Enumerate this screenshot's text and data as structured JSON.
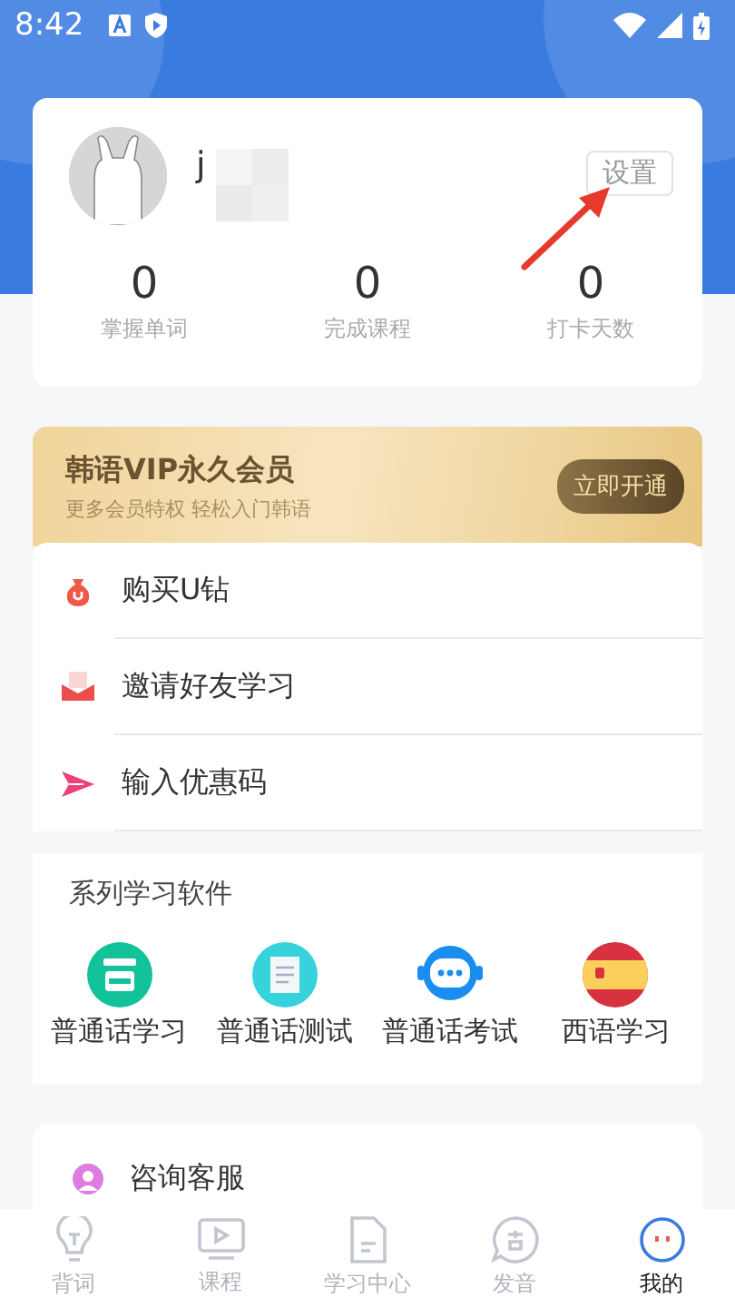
{
  "status_bar": {
    "time": "8:42"
  },
  "profile": {
    "name": "j",
    "settings_button": "设置",
    "stats": [
      {
        "value": "0",
        "label": "掌握单词"
      },
      {
        "value": "0",
        "label": "完成课程"
      },
      {
        "value": "0",
        "label": "打卡天数"
      }
    ]
  },
  "vip": {
    "title": "韩语VIP永久会员",
    "subtitle": "更多会员特权 轻松入门韩语",
    "button": "立即开通"
  },
  "menu": [
    {
      "label": "购买U钻",
      "kind": "bag"
    },
    {
      "label": "邀请好友学习",
      "kind": "envelope"
    },
    {
      "label": "输入优惠码",
      "kind": "plane"
    }
  ],
  "apps": {
    "title": "系列学习软件",
    "items": [
      {
        "label": "普通话学习",
        "kind": "green"
      },
      {
        "label": "普通话测试",
        "kind": "document"
      },
      {
        "label": "普通话考试",
        "kind": "chat"
      },
      {
        "label": "西语学习",
        "kind": "flag"
      }
    ]
  },
  "service": {
    "label": "咨询客服"
  },
  "tabs": [
    {
      "label": "背词",
      "kind": "bulb",
      "selected": false
    },
    {
      "label": "课程",
      "kind": "video",
      "selected": false
    },
    {
      "label": "学习中心",
      "kind": "doc",
      "selected": false
    },
    {
      "label": "发音",
      "kind": "speech",
      "selected": false
    },
    {
      "label": "我的",
      "kind": "face",
      "selected": true
    }
  ]
}
